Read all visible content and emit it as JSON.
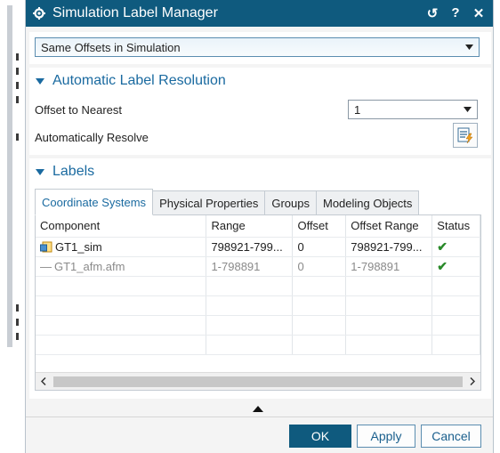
{
  "window": {
    "title": "Simulation Label Manager",
    "actions": [
      "reset-icon",
      "help-icon",
      "close-icon"
    ],
    "accent": "#0f5a7e"
  },
  "mode_select": {
    "value": "Same Offsets in Simulation"
  },
  "auto_section": {
    "title": "Automatic Label Resolution",
    "offset_label": "Offset to Nearest",
    "offset_value": "1",
    "resolve_label": "Automatically Resolve"
  },
  "labels_section": {
    "title": "Labels",
    "tabs": [
      {
        "label": "Coordinate Systems"
      },
      {
        "label": "Physical Properties"
      },
      {
        "label": "Groups"
      },
      {
        "label": "Modeling Objects"
      }
    ],
    "columns": [
      "Component",
      "Range",
      "Offset",
      "Offset Range",
      "Status"
    ],
    "rows": [
      {
        "component": "GT1_sim",
        "range": "798921-799...",
        "offset": "0",
        "offset_range": "798921-799...",
        "status": "ok"
      },
      {
        "component": "GT1_afm.afm",
        "range": "1-798891",
        "offset": "0",
        "offset_range": "1-798891",
        "status": "ok"
      }
    ]
  },
  "buttons": {
    "ok": "OK",
    "apply": "Apply",
    "cancel": "Cancel"
  }
}
